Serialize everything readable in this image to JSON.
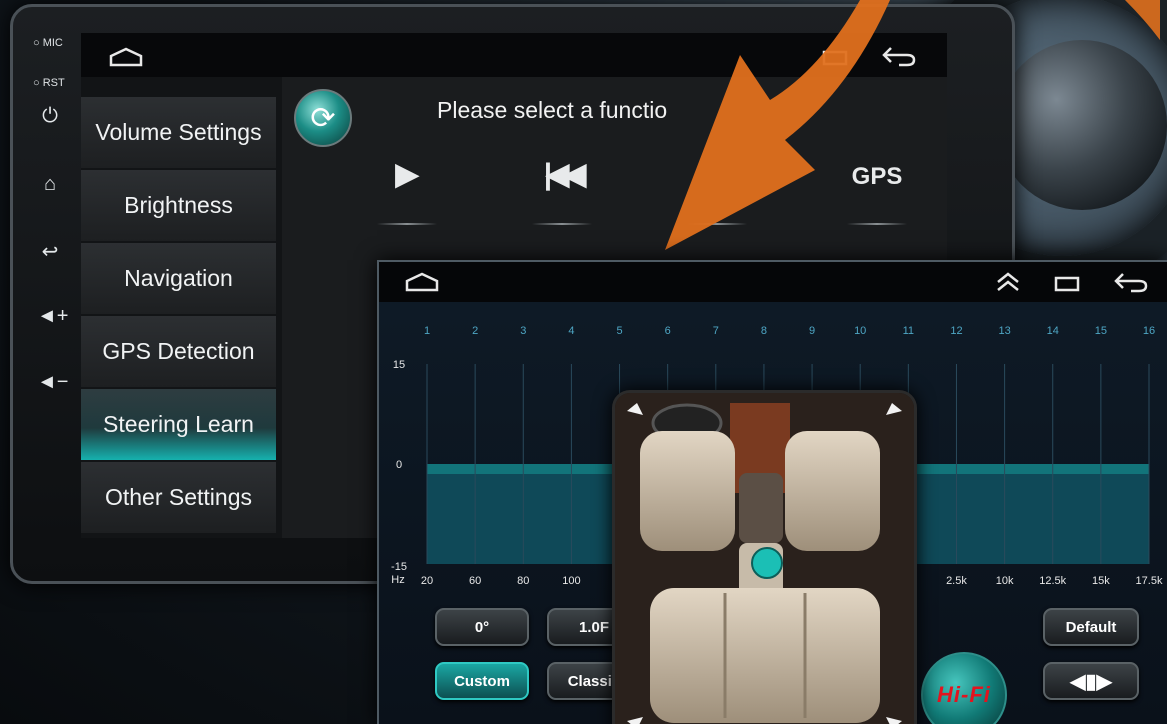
{
  "device": {
    "mic_label": "MIC",
    "rst_label": "RST",
    "side_icons": [
      "power-icon",
      "home-icon",
      "back-icon",
      "volume-up-icon",
      "volume-down-icon"
    ]
  },
  "settings_menu": {
    "items": [
      {
        "label": "Volume Settings",
        "active": false
      },
      {
        "label": "Brightness",
        "active": false
      },
      {
        "label": "Navigation",
        "active": false
      },
      {
        "label": "GPS Detection",
        "active": false
      },
      {
        "label": "Steering Learn",
        "active": true
      },
      {
        "label": "Other Settings",
        "active": false
      }
    ]
  },
  "function_panel": {
    "title": "Please select a functio",
    "functions": [
      "play-icon",
      "previous-track-icon",
      "GPS"
    ]
  },
  "equalizer": {
    "band_numbers": [
      "1",
      "2",
      "3",
      "4",
      "5",
      "6",
      "7",
      "8",
      "9",
      "10",
      "11",
      "12",
      "13",
      "14",
      "15",
      "16"
    ],
    "y_labels": {
      "top": "15",
      "mid": "0",
      "bottom": "-15",
      "unit": "Hz"
    },
    "freq_labels": [
      "20",
      "60",
      "80",
      "100",
      "2.5k",
      "10k",
      "12.5k",
      "15k",
      "17.5k"
    ],
    "band_levels_db": [
      0,
      0,
      0,
      0,
      0,
      0,
      0,
      0,
      0,
      0,
      0,
      0,
      0,
      0,
      0,
      0
    ],
    "buttons": {
      "angle": "0°",
      "fade": "1.0F",
      "custom": "Custom",
      "classic": "Classic",
      "default": "Default",
      "hifi": "Hi-Fi"
    },
    "accent": "#17a8a4"
  }
}
